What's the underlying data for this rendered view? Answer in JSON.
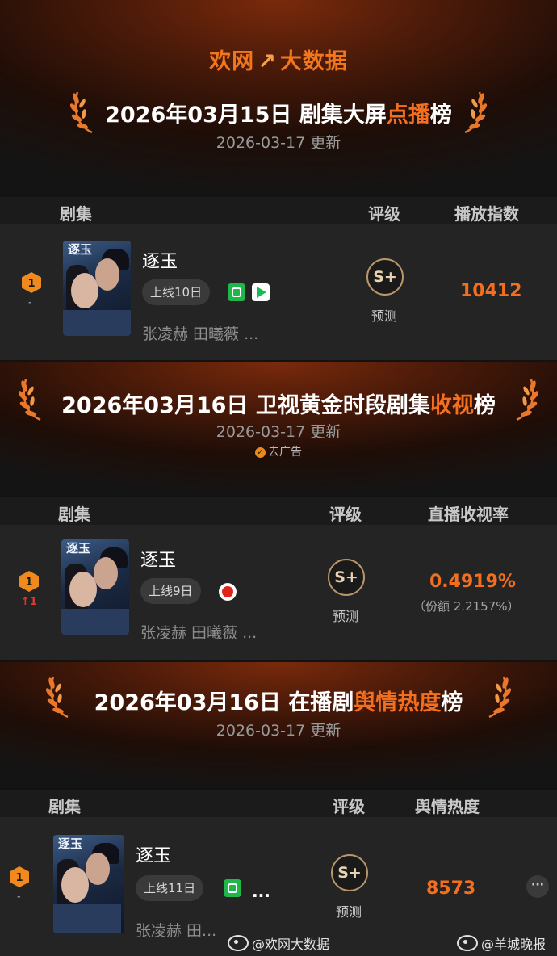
{
  "logo": {
    "left": "欢网",
    "mark": "↗",
    "right": "大数据"
  },
  "boards": [
    {
      "title_prefix": "2026年03月15日 剧集大屏",
      "title_highlight": "点播",
      "title_suffix": "榜",
      "updated": "2026-03-17 更新",
      "columns": {
        "drama": "剧集",
        "grade": "评级",
        "metric": "播放指数"
      },
      "row": {
        "rank": "1",
        "rank_change": "-",
        "poster_text": "逐玉",
        "title": "逐玉",
        "days": "上线10日",
        "platforms": [
          "iqiyi",
          "tencent"
        ],
        "cast": "张凌赫 田曦薇 ...",
        "grade": "S+",
        "grade_label": "预测",
        "value": "10412"
      }
    },
    {
      "title_prefix": "2026年03月16日 卫视黄金时段剧集",
      "title_highlight": "收视",
      "title_suffix": "榜",
      "updated": "2026-03-17 更新",
      "adfree": "去广告",
      "columns": {
        "drama": "剧集",
        "grade": "评级",
        "metric": "直播收视率"
      },
      "row": {
        "rank": "1",
        "rank_change": "↑1",
        "poster_text": "逐玉",
        "title": "逐玉",
        "days": "上线9日",
        "platforms": [
          "dragon-tv"
        ],
        "cast": "张凌赫 田曦薇 ...",
        "grade": "S+",
        "grade_label": "预测",
        "value": "0.4919%",
        "subvalue": "（份额 2.2157%）"
      }
    },
    {
      "title_prefix": "2026年03月16日 在播剧",
      "title_highlight": "舆情热度",
      "title_suffix": "榜",
      "updated": "2026-03-17 更新",
      "columns": {
        "drama": "剧集",
        "grade": "评级",
        "metric": "舆情热度"
      },
      "row": {
        "rank": "1",
        "rank_change": "-",
        "poster_text": "逐玉",
        "title": "逐玉",
        "days": "上线11日",
        "platforms": [
          "iqiyi"
        ],
        "more": "...",
        "cast": "张凌赫 田...",
        "grade": "S+",
        "grade_label": "预测",
        "value": "8573",
        "menu": "···"
      }
    }
  ],
  "watermarks": {
    "left": "@欢网大数据",
    "right": "@羊城晚报"
  },
  "colors": {
    "accent": "#f36f1e",
    "background": "#121212",
    "row": "#242424",
    "rank_up": "#e0382a"
  }
}
